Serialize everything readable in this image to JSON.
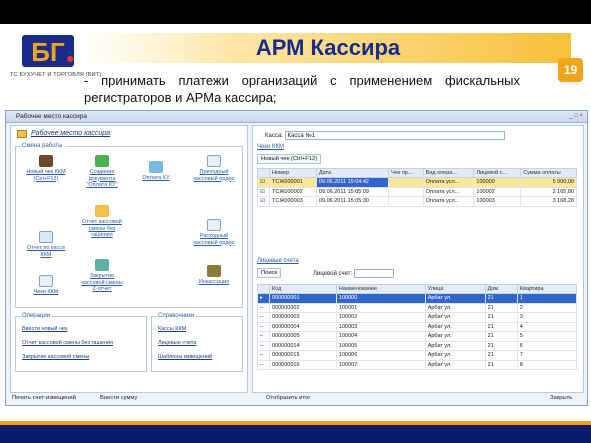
{
  "slide": {
    "title": "АРМ Кассира",
    "page_number": "19",
    "logo_text": "ТС БУХУЧЕТ И ТОРГОВЛЯ (БИТ)",
    "bullet": "- принимать платежи организаций с применением фискальных регистраторов и АРМа кассира;"
  },
  "window": {
    "title": "Рабочее место кассира",
    "controls": "_ □ ×"
  },
  "left": {
    "title": "Рабочее место кассира",
    "shift_group": "Смена работы",
    "icons": [
      {
        "name": "new-check",
        "label": "Новый чек ККМ (Ctrl+F12)"
      },
      {
        "name": "create-doc",
        "label": "Создание документа \"Оплата КУ\""
      },
      {
        "name": "pay-ku",
        "label": "Оплата КУ"
      },
      {
        "name": "income-order",
        "label": "Приходный кассовый ордер"
      },
      {
        "name": "report-no-cancel",
        "label": "Отчет кассовой смены без гашения"
      },
      {
        "name": "close-shift",
        "label": "Закрытие кассовой смены Z-отчет"
      },
      {
        "name": "report-on-kkm",
        "label": "Отчет по кассе ККМ"
      },
      {
        "name": "checks-kkm",
        "label": "Чеки ККМ"
      },
      {
        "name": "expense-order",
        "label": "Расходный кассовый ордер"
      },
      {
        "name": "collection",
        "label": "Инкассация"
      }
    ],
    "ops_group": "Операции",
    "ops": [
      "Ввести новый чек",
      "Отчет кассовой смены без гашения",
      "Закрытие кассовой смены"
    ],
    "refs_group": "Справочники",
    "refs": [
      "Кассы ККМ",
      "Лицевые счета",
      "Шаблоны извещений"
    ],
    "print_btn": "Печать счет-извещений",
    "deposit_btn": "Внести сумму"
  },
  "right": {
    "cash_label": "Касса:",
    "cash_value": "Касса №1",
    "checks_section": "Чеки ККМ",
    "new_check_btn": "Новый чек (Ctrl+F12)",
    "checks_columns": [
      "Номер",
      "Дата",
      "Чек пр...",
      "Вид опера...",
      "Лицевой с...",
      "Сумма оплаты"
    ],
    "checks_rows": [
      [
        "ТСЖ000001",
        "09.06.2011 15:04:42",
        "",
        "Оплата усл...",
        "100000",
        "5 000,00"
      ],
      [
        "ТСЖ000002",
        "09.06.2011 15:05:09",
        "",
        "Оплата усл...",
        "100002",
        "2 165,80"
      ],
      [
        "ТСЖ000003",
        "09.06.2011 15:05:30",
        "",
        "Оплата усл...",
        "100003",
        "3 168,28"
      ]
    ],
    "accounts_section": "Лицевые счета",
    "search_btn": "Поиск",
    "account_label": "Лицевой счет:",
    "acc_columns": [
      "Код",
      "Наименование",
      "Улица",
      "Дом",
      "Квартира"
    ],
    "acc_rows": [
      [
        "000000001",
        "100000",
        "Арбат ул.",
        "21",
        "1"
      ],
      [
        "000000002",
        "100001",
        "Арбат ул.",
        "21",
        "2"
      ],
      [
        "000000003",
        "100002",
        "Арбат ул.",
        "21",
        "3"
      ],
      [
        "000000004",
        "100003",
        "Арбат ул.",
        "21",
        "4"
      ],
      [
        "000000005",
        "100004",
        "Арбат ул.",
        "21",
        "5"
      ],
      [
        "000000014",
        "100005",
        "Арбат ул.",
        "21",
        "6"
      ],
      [
        "000000015",
        "100006",
        "Арбат ул.",
        "21",
        "7"
      ],
      [
        "000000016",
        "100007",
        "Арбат ул.",
        "21",
        "8"
      ]
    ],
    "show_totals": "Отобразить итог",
    "close_btn": "Закрыть"
  }
}
